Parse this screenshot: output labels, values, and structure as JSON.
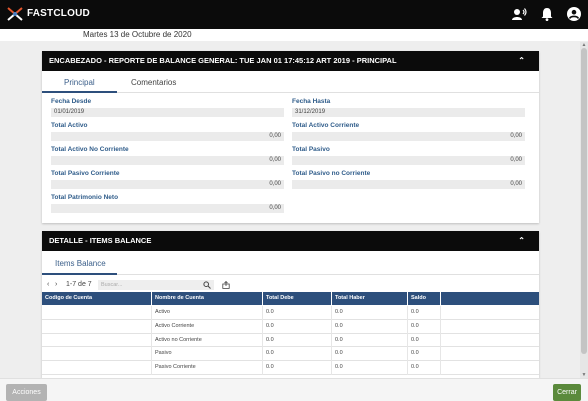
{
  "app": {
    "brand": "FASTCLOUD"
  },
  "topbar": {
    "icons": [
      "user-voice-icon",
      "bell-icon",
      "account-icon"
    ]
  },
  "date_text": "Martes 13 de Octubre de 2020",
  "header_card": {
    "title": "ENCABEZADO - REPORTE DE BALANCE GENERAL: TUE JAN 01 17:45:12 ART 2019 - PRINCIPAL",
    "tabs": [
      "Principal",
      "Comentarios"
    ],
    "fields": {
      "fecha_desde": {
        "label": "Fecha Desde",
        "value": "01/01/2019"
      },
      "fecha_hasta": {
        "label": "Fecha Hasta",
        "value": "31/12/2019"
      },
      "total_activo": {
        "label": "Total Activo",
        "value": "0,00"
      },
      "total_activo_corriente": {
        "label": "Total Activo Corriente",
        "value": "0,00"
      },
      "total_activo_no_corriente": {
        "label": "Total Activo No Corriente",
        "value": "0,00"
      },
      "total_pasivo": {
        "label": "Total Pasivo",
        "value": "0,00"
      },
      "total_pasivo_corriente": {
        "label": "Total Pasivo Corriente",
        "value": "0,00"
      },
      "total_pasivo_no_corriente": {
        "label": "Total Pasivo no Corriente",
        "value": "0,00"
      },
      "total_patrimonio_neto": {
        "label": "Total Patrimonio Neto",
        "value": "0,00"
      }
    }
  },
  "detail_card": {
    "title": "DETALLE - ITEMS BALANCE",
    "tab": "Items Balance",
    "pager": "1-7 de 7",
    "search_placeholder": "Buscar...",
    "columns": [
      "Codigo de Cuenta",
      "Nombre de Cuenta",
      "Total Debe",
      "Total Haber",
      "Saldo"
    ],
    "rows": [
      [
        "",
        "Activo",
        "0.0",
        "0.0",
        "0.0"
      ],
      [
        "",
        "Activo Corriente",
        "0.0",
        "0.0",
        "0.0"
      ],
      [
        "",
        "Activo no Corriente",
        "0.0",
        "0.0",
        "0.0"
      ],
      [
        "",
        "Pasivo",
        "0.0",
        "0.0",
        "0.0"
      ],
      [
        "",
        "Pasivo Corriente",
        "0.0",
        "0.0",
        "0.0"
      ]
    ]
  },
  "footer": {
    "acciones": "Acciones",
    "cerrar": "Cerrar"
  },
  "colors": {
    "accent": "#2d4f7c",
    "header": "#0b0b0b",
    "close_button": "#5b8a3c",
    "acciones_button": "#b3b3b3"
  }
}
